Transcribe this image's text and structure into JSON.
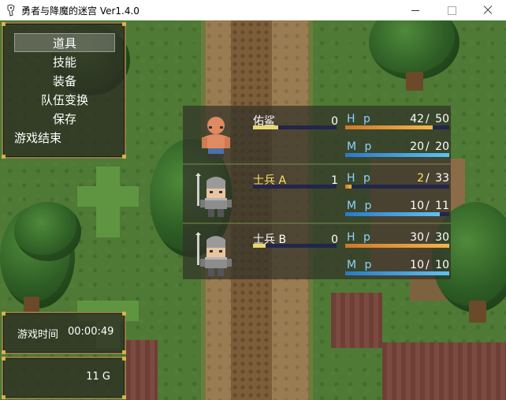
{
  "window": {
    "title": "勇者与降魔的迷宫 Ver1.4.0"
  },
  "menu": {
    "items": [
      {
        "label": "道具",
        "selected": true
      },
      {
        "label": "技能",
        "selected": false
      },
      {
        "label": "装备",
        "selected": false
      },
      {
        "label": "队伍变换",
        "selected": false
      },
      {
        "label": "保存",
        "selected": false
      },
      {
        "label": "游戏结束",
        "selected": false
      }
    ]
  },
  "playtime": {
    "label": "游戏时间",
    "value": "00:00:49"
  },
  "gold": {
    "value": "11 G"
  },
  "party": [
    {
      "name": "佑鲨",
      "level": "0",
      "hp": {
        "label": "H p",
        "current": "42",
        "max": "50",
        "ratio": 0.84
      },
      "mp": {
        "label": "M p",
        "current": "20",
        "max": "20",
        "ratio": 1.0
      },
      "face": "bald-brawler-face-icon"
    },
    {
      "name": "士兵 A",
      "level": "1",
      "hp": {
        "label": "H p",
        "current": "2",
        "max": "33",
        "ratio": 0.06
      },
      "mp": {
        "label": "M p",
        "current": "10",
        "max": "11",
        "ratio": 0.91
      },
      "face": "armored-soldier-face-icon"
    },
    {
      "name": "士兵 B",
      "level": "0",
      "hp": {
        "label": "H p",
        "current": "30",
        "max": "30",
        "ratio": 1.0
      },
      "mp": {
        "label": "M p",
        "current": "10",
        "max": "10",
        "ratio": 1.0
      },
      "face": "armored-soldier-face-icon"
    }
  ],
  "colors": {
    "hp_gauge": "#f3b54a",
    "mp_gauge": "#5cc2f2",
    "system_label": "#8fd0ff",
    "warning_text": "#ffe066",
    "window_border": "#8c7a45"
  }
}
